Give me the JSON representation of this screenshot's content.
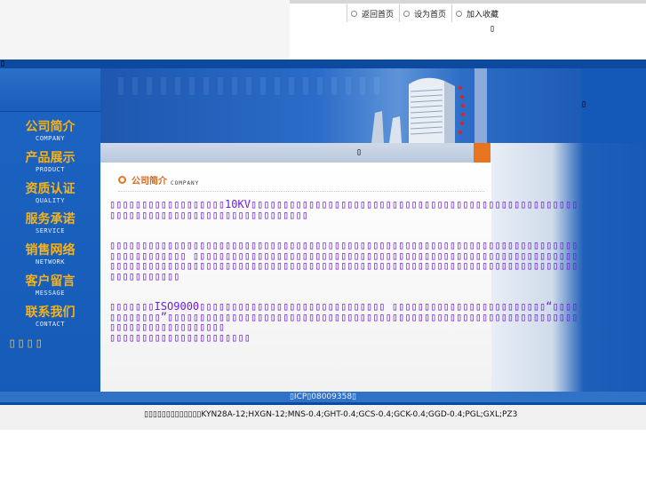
{
  "top_links": [
    {
      "label": "返回首页"
    },
    {
      "label": "设为首页"
    },
    {
      "label": "加入收藏"
    }
  ],
  "glyphs": {
    "missing": "▯"
  },
  "nav": [
    {
      "zh": "公司简介",
      "en": "COMPANY"
    },
    {
      "zh": "产品展示",
      "en": "PRODUCT"
    },
    {
      "zh": "资质认证",
      "en": "QUALITY"
    },
    {
      "zh": "服务承诺",
      "en": "SERVICE"
    },
    {
      "zh": "销售网络",
      "en": "NETWORK"
    },
    {
      "zh": "客户留言",
      "en": "MESSAGE"
    },
    {
      "zh": "联系我们",
      "en": "CONTACT"
    }
  ],
  "left_bottom_text": "▯▯▯▯",
  "section": {
    "title_zh": "公司简介",
    "title_en": "COMPANY"
  },
  "content": {
    "p1": "▯▯▯▯▯▯▯▯▯▯▯▯▯▯▯▯▯▯10KV▯▯▯▯▯▯▯▯▯▯▯▯▯▯▯▯▯▯▯▯▯▯▯▯▯▯▯▯▯▯▯▯▯▯▯▯▯▯▯▯▯▯▯▯▯▯▯▯▯▯▯▯▯▯▯▯▯▯▯▯▯▯▯▯▯▯▯▯▯▯▯▯▯▯▯▯▯▯▯▯▯▯",
    "p2": "▯▯▯▯▯▯▯▯▯▯▯▯▯▯▯▯▯▯▯▯▯▯▯▯▯▯▯▯▯▯▯▯▯▯▯▯▯▯▯▯▯▯▯▯▯▯▯▯▯▯▯▯▯▯▯▯▯▯▯▯▯▯▯▯▯▯▯▯▯▯▯▯▯▯▯▯▯▯▯▯▯▯▯▯▯ ▯▯▯▯▯▯▯▯▯▯▯▯▯▯▯▯▯▯▯▯▯▯▯▯▯▯▯▯▯▯▯▯▯▯▯▯▯▯▯▯▯▯▯▯▯▯▯▯▯▯▯▯▯▯▯▯▯▯▯▯▯▯▯▯▯▯▯▯▯▯▯▯▯▯▯▯▯▯▯▯▯▯▯▯▯▯▯▯▯▯▯▯▯▯▯▯▯▯▯▯▯▯▯▯▯▯▯▯▯▯▯▯▯▯▯▯▯▯▯▯▯▯▯▯▯▯▯▯▯▯▯▯▯▯▯▯▯▯▯▯▯▯▯▯",
    "p3a": "▯▯▯▯▯▯▯ISO9000▯▯▯▯▯▯▯▯▯▯▯▯▯▯▯▯▯▯▯▯▯▯▯▯▯▯▯▯▯ ▯▯▯▯▯▯▯▯▯▯▯▯▯▯▯▯▯▯▯▯▯▯▯▯“▯▯▯▯▯▯▯▯▯▯▯▯”▯▯▯▯▯▯▯▯▯▯▯▯▯▯▯▯▯▯▯▯▯▯▯▯▯▯▯▯▯▯▯▯▯▯▯▯▯▯▯▯▯▯▯▯▯▯▯▯▯▯▯▯▯▯▯▯▯▯▯▯▯▯▯▯▯▯▯▯▯▯▯▯▯▯▯▯▯▯▯▯▯▯",
    "p3b": "▯▯▯▯▯▯▯▯▯▯▯▯▯▯▯▯▯▯▯▯▯▯"
  },
  "footer": {
    "icp": "▯ICP▯08009358▯",
    "keywords": "▯▯▯▯▯▯▯▯▯▯▯▯▯KYN28A-12;HXGN-12;MNS-0.4;GHT-0.4;GCS-0.4;GCK-0.4;GGD-0.4;PGL;GXL;PZ3"
  },
  "colors": {
    "nav_text": "#f5b21b",
    "content_text": "#6a1fd6",
    "accent_orange": "#e8741f",
    "header_blue": "#0c4aa0"
  }
}
